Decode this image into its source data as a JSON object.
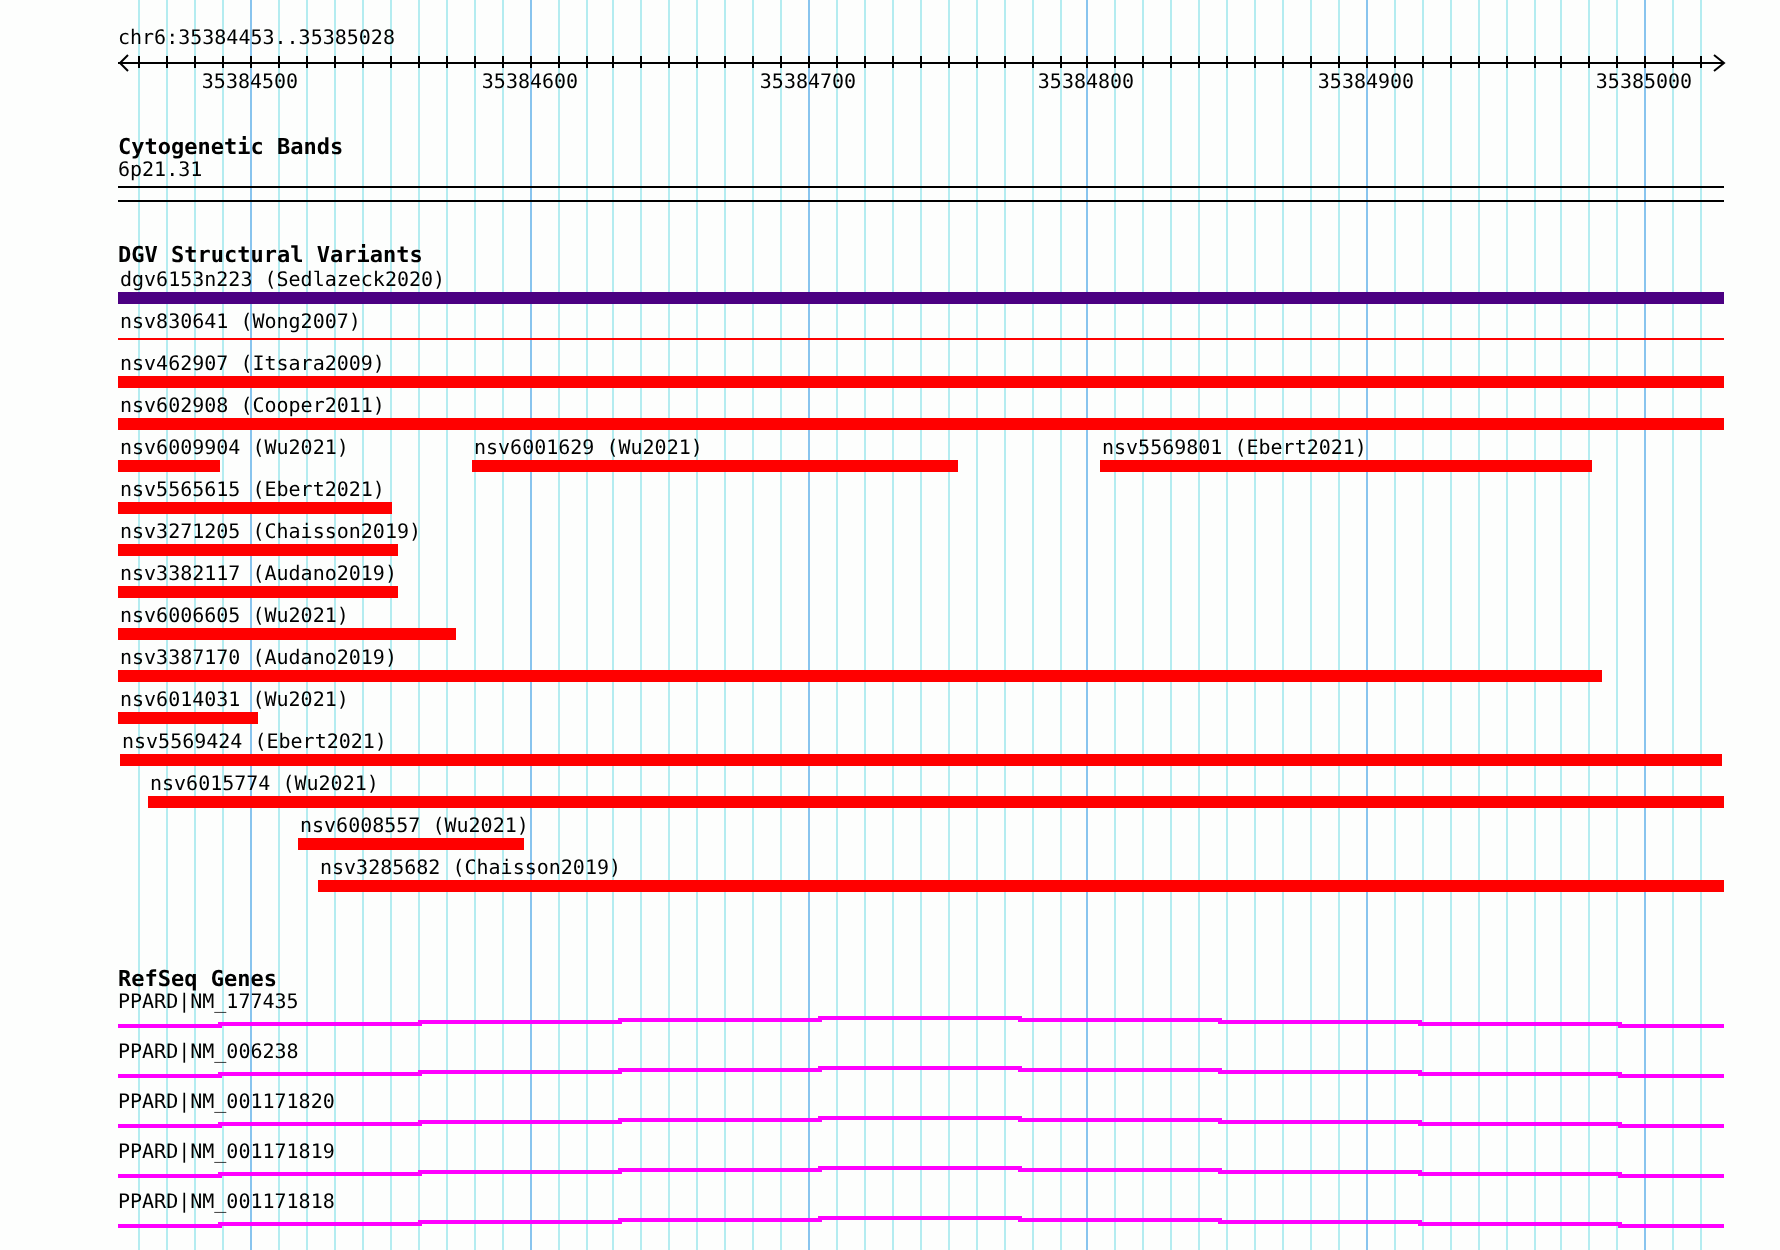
{
  "ruler": {
    "location": "chr6:35384453..35385028",
    "ticks": [
      "35384500",
      "35384600",
      "35384700",
      "35384800",
      "35384900",
      "35385000"
    ]
  },
  "tracks": [
    {
      "kind": "bands",
      "title": "Cytogenetic Bands",
      "items": [
        {
          "label": "6p21.31"
        }
      ]
    },
    {
      "kind": "variants",
      "title": "DGV Structural Variants",
      "rows": [
        [
          {
            "label": "dgv6153n223 (Sedlazeck2020)",
            "kind": "bar",
            "color": "#4b0082"
          }
        ],
        [
          {
            "label": "nsv830641 (Wong2007)",
            "kind": "line",
            "color": "#ff0000"
          }
        ],
        [
          {
            "label": "nsv462907 (Itsara2009)",
            "kind": "bar",
            "color": "#ff0000"
          }
        ],
        [
          {
            "label": "nsv602908 (Cooper2011)",
            "kind": "bar",
            "color": "#ff0000"
          }
        ],
        [
          {
            "label": "nsv6009904 (Wu2021)",
            "kind": "bar",
            "color": "#ff0000"
          },
          {
            "label": "nsv6001629 (Wu2021)",
            "kind": "bar",
            "color": "#ff0000"
          },
          {
            "label": "nsv5569801 (Ebert2021)",
            "kind": "bar",
            "color": "#ff0000"
          }
        ],
        [
          {
            "label": "nsv5565615 (Ebert2021)",
            "kind": "bar",
            "color": "#ff0000"
          }
        ],
        [
          {
            "label": "nsv3271205 (Chaisson2019)",
            "kind": "bar",
            "color": "#ff0000"
          }
        ],
        [
          {
            "label": "nsv3382117 (Audano2019)",
            "kind": "bar",
            "color": "#ff0000"
          }
        ],
        [
          {
            "label": "nsv6006605 (Wu2021)",
            "kind": "bar",
            "color": "#ff0000"
          }
        ],
        [
          {
            "label": "nsv3387170 (Audano2019)",
            "kind": "bar",
            "color": "#ff0000"
          }
        ],
        [
          {
            "label": "nsv6014031 (Wu2021)",
            "kind": "bar",
            "color": "#ff0000"
          }
        ],
        [
          {
            "label": "nsv5569424 (Ebert2021)",
            "kind": "bar",
            "color": "#ff0000"
          }
        ],
        [
          {
            "label": "nsv6015774 (Wu2021)",
            "kind": "bar",
            "color": "#ff0000"
          }
        ],
        [
          {
            "label": "nsv6008557 (Wu2021)",
            "kind": "bar",
            "color": "#ff0000"
          }
        ],
        [
          {
            "label": "nsv3285682 (Chaisson2019)",
            "kind": "bar",
            "color": "#ff0000"
          }
        ]
      ]
    },
    {
      "kind": "genes",
      "title": "RefSeq Genes",
      "items": [
        {
          "label": "PPARD|NM_177435"
        },
        {
          "label": "PPARD|NM_006238"
        },
        {
          "label": "PPARD|NM_001171820"
        },
        {
          "label": "PPARD|NM_001171819"
        },
        {
          "label": "PPARD|NM_001171818"
        }
      ]
    }
  ]
}
